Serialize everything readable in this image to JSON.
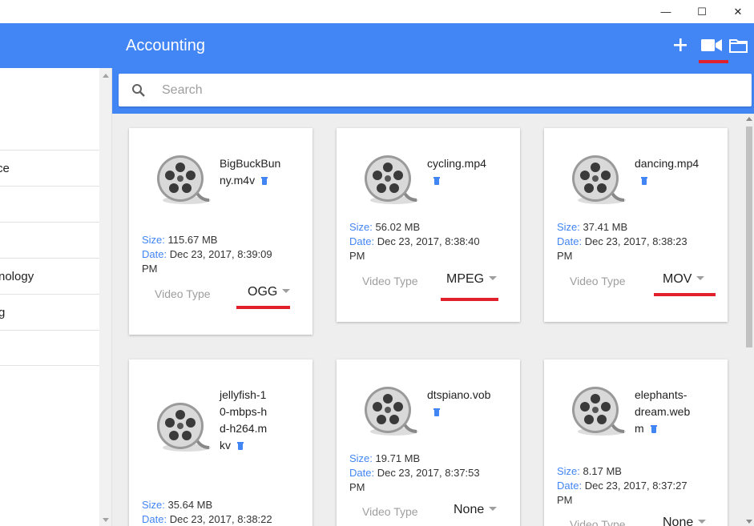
{
  "window": {
    "minimize": "—",
    "maximize": "☐",
    "close": "✕"
  },
  "sidebar": {
    "items": [
      {
        "label": "ce"
      },
      {
        "label": ""
      },
      {
        "label": ""
      },
      {
        "label": "nology"
      },
      {
        "label": "g"
      },
      {
        "label": ""
      }
    ]
  },
  "header": {
    "title": "Accounting",
    "add_icon": "plus-icon",
    "video_icon": "video-camera-icon",
    "folder_icon": "folder-icon",
    "accent": "#4285f4",
    "highlight": "#e0212b"
  },
  "search": {
    "placeholder": "Search",
    "value": ""
  },
  "labels": {
    "size": "Size:",
    "date": "Date:",
    "video_type": "Video Type"
  },
  "files": [
    {
      "name": "BigBuckBunny.m4v",
      "size": "115.67 MB",
      "date": "Dec 23, 2017, 8:39:09",
      "date2": "PM",
      "type": "OGG"
    },
    {
      "name": "cycling.mp4",
      "size": "56.02 MB",
      "date": "Dec 23, 2017, 8:38:40",
      "date2": "PM",
      "type": "MPEG"
    },
    {
      "name": "dancing.mp4",
      "size": "37.41 MB",
      "date": "Dec 23, 2017, 8:38:23",
      "date2": "PM",
      "type": "MOV"
    },
    {
      "name": "jellyfish-10-mbps-hd-h264.mkv",
      "size": "35.64 MB",
      "date": "Dec 23, 2017, 8:38:22",
      "date2": "",
      "type": ""
    },
    {
      "name": "dtspiano.vob",
      "size": "19.71 MB",
      "date": "Dec 23, 2017, 8:37:53",
      "date2": "PM",
      "type": "None"
    },
    {
      "name": "elephants-dream.webm",
      "size": "8.17 MB",
      "date": "Dec 23, 2017, 8:37:27",
      "date2": "PM",
      "type": "None"
    }
  ]
}
